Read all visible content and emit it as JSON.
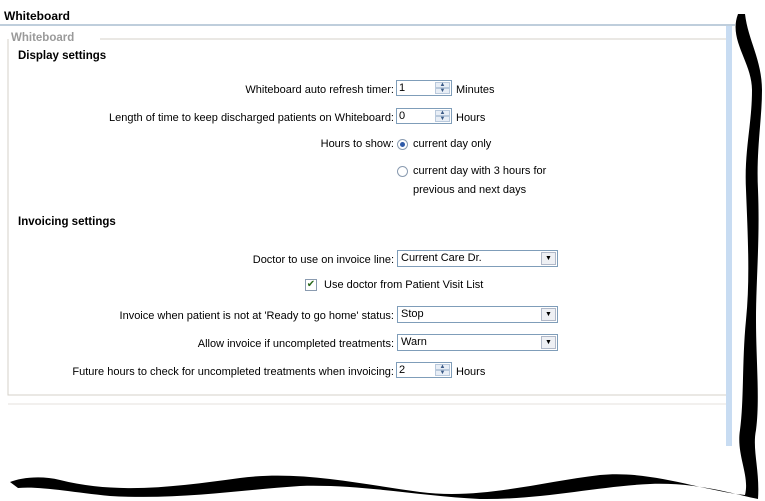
{
  "window": {
    "title": "Whiteboard"
  },
  "group": {
    "legend": "Whiteboard"
  },
  "display": {
    "heading": "Display settings",
    "refresh": {
      "label": "Whiteboard auto refresh timer:",
      "value": "1",
      "unit": "Minutes"
    },
    "discharged": {
      "label": "Length of time to keep discharged patients on Whiteboard:",
      "value": "0",
      "unit": "Hours"
    },
    "hours_to_show": {
      "label": "Hours to show:",
      "options": [
        "current day only",
        "current day with 3 hours for",
        "previous and next days"
      ],
      "selected": "current day only"
    }
  },
  "invoicing": {
    "heading": "Invoicing settings",
    "doctor": {
      "label": "Doctor to use on invoice line:",
      "value": "Current Care Dr."
    },
    "use_visit_list": {
      "label": "Use doctor from Patient Visit List",
      "checked": true
    },
    "not_ready": {
      "label": "Invoice when patient is not at 'Ready to go home' status:",
      "value": "Stop"
    },
    "uncompleted": {
      "label": "Allow invoice if uncompleted treatments:",
      "value": "Warn"
    },
    "future_hours": {
      "label": "Future hours to check for uncompleted treatments when invoicing:",
      "value": "2",
      "unit": "Hours"
    }
  },
  "colors": {
    "frame_border": "#7f9db9",
    "group_border": "#d4d0c8",
    "scrollbar": "#c8dcf2",
    "shadow": "#000000"
  }
}
